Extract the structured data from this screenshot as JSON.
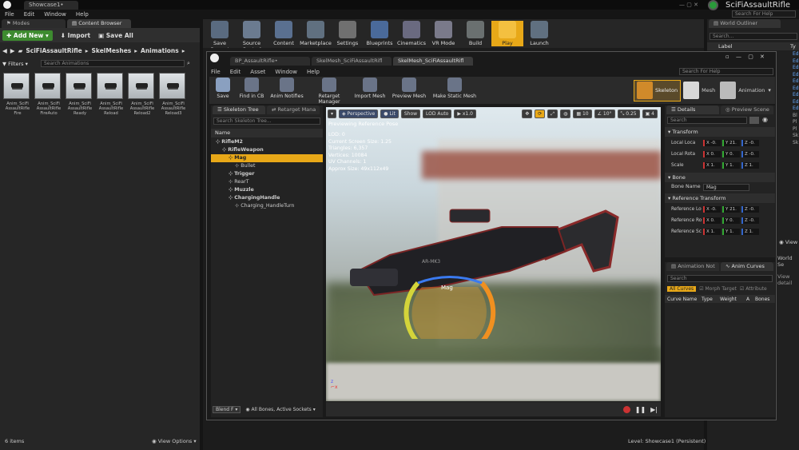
{
  "app": {
    "tab": "Showcase1•",
    "title": "SciFiAssaultRifle",
    "search_help": "Search For Help"
  },
  "menu": [
    "File",
    "Edit",
    "Window",
    "Help"
  ],
  "left": {
    "tabs": [
      "Modes",
      "Content Browser"
    ],
    "add_new": "Add New",
    "import": "Import",
    "save_all": "Save All",
    "path": [
      "SciFiAssaultRifle",
      "SkelMeshes",
      "Animations"
    ],
    "filters": "Filters",
    "search_placeholder": "Search Animations",
    "assets": [
      [
        "Anim_SciFi",
        "AssaultRifle",
        "Fire"
      ],
      [
        "Anim_SciFi",
        "AssaultRifle",
        "FireAuto"
      ],
      [
        "Anim_SciFi",
        "AssaultRifle",
        "Ready"
      ],
      [
        "Anim_SciFi",
        "AssaultRifle",
        "Reload"
      ],
      [
        "Anim_SciFi",
        "AssaultRifle",
        "Reload2"
      ],
      [
        "Anim_SciFi",
        "AssaultRifle",
        "Reload3"
      ]
    ],
    "count": "6 items",
    "view_options": "View Options"
  },
  "toolbar": [
    "Save Current",
    "Source Control",
    "Content",
    "Marketplace",
    "Settings",
    "Blueprints",
    "Cinematics",
    "VR Mode",
    "Build",
    "Play",
    "Launch"
  ],
  "outliner": {
    "title": "World Outliner",
    "search": "Search...",
    "label_col": "Label",
    "type_col": "Ty",
    "right_items": [
      "Ed",
      "Ed",
      "Ed",
      "Ed",
      "Ed",
      "Ed",
      "Ed",
      "Ed",
      "Ed",
      "Bl",
      "Pl",
      "Pl",
      "Sk",
      "Sk"
    ],
    "view": "View",
    "world_se": "World Se",
    "view_detail": "View detail"
  },
  "editor": {
    "tabs": [
      "BP_AssaultRifle•",
      "SkelMesh_SciFiAssaultRifl",
      "SkelMesh_SciFiAssaultRifl"
    ],
    "menu": [
      "File",
      "Edit",
      "Asset",
      "Window",
      "Help"
    ],
    "search_help": "Search For Help",
    "tools": [
      "Save",
      "Find in CB",
      "Anim Notifies",
      "Retarget Manager",
      "Import Mesh",
      "Preview Mesh",
      "Make Static Mesh"
    ],
    "modes": [
      "Skeleton",
      "Mesh",
      "Animation"
    ]
  },
  "skeleton": {
    "tabs": [
      "Skeleton Tree",
      "Retarget Mana"
    ],
    "search": "Search Skeleton Tree...",
    "name_col": "Name",
    "bones": [
      {
        "name": "RifleM2",
        "depth": 0,
        "bold": true
      },
      {
        "name": "RifleWeapon",
        "depth": 1,
        "bold": true
      },
      {
        "name": "Mag",
        "depth": 2,
        "bold": true,
        "selected": true
      },
      {
        "name": "Bullet",
        "depth": 3,
        "bold": false
      },
      {
        "name": "Trigger",
        "depth": 2,
        "bold": true
      },
      {
        "name": "RearT",
        "depth": 2,
        "bold": false
      },
      {
        "name": "Muzzle",
        "depth": 2,
        "bold": true
      },
      {
        "name": "ChargingHandle",
        "depth": 2,
        "bold": true
      },
      {
        "name": "Charging_HandleTurn",
        "depth": 3,
        "bold": false
      }
    ],
    "blend": "Blend F",
    "filter": "All Bones, Active Sockets"
  },
  "viewport": {
    "perspective": "Perspective",
    "lit": "Lit",
    "show": "Show",
    "lod": "LOD Auto",
    "speed": "x1.0",
    "preview": "Previewing Reference Pose",
    "stats": [
      "LOD: 0",
      "Current Screen Size: 1.25",
      "Triangles: 6,357",
      "Vertices: 10084",
      "UV Channels: 1",
      "Approx Size: 49x112x49"
    ],
    "grid": "10",
    "angle": "10°",
    "scale": "0.25",
    "cam": "4",
    "bone_label": "Mag",
    "gun_text": "AR-MK3"
  },
  "details": {
    "tabs": [
      "Details",
      "Preview Scene"
    ],
    "search": "Search",
    "transform": "Transform",
    "rows": [
      {
        "label": "Local Loca",
        "x": "X -0.",
        "y": "Y 21.",
        "z": "Z -0."
      },
      {
        "label": "Local Rota",
        "x": "X 0.",
        "y": "Y 0.",
        "z": "Z -0."
      },
      {
        "label": "Scale",
        "x": "X 1.",
        "y": "Y 1.",
        "z": "Z 1."
      }
    ],
    "bone": "Bone",
    "bone_name_label": "Bone Name",
    "bone_name": "Mag",
    "ref": "Reference Transform",
    "ref_rows": [
      {
        "label": "Reference Lo",
        "x": "X -0.",
        "y": "Y 21.",
        "z": "Z -0."
      },
      {
        "label": "Reference Ro",
        "x": "X 0.",
        "y": "Y 0.",
        "z": "Z -0."
      },
      {
        "label": "Reference Sc",
        "x": "X 1.",
        "y": "Y 1.",
        "z": "Z 1."
      }
    ]
  },
  "curves": {
    "tabs": [
      "Animation Not",
      "Anim Curves"
    ],
    "search": "Search",
    "all": "All Curves",
    "morph": "Morph Target",
    "attr": "Attribute",
    "cols": [
      "Curve Name",
      "Type",
      "Weight",
      "A",
      "Bones"
    ]
  },
  "status": {
    "level": "Level:",
    "level_name": "Showcase1 (Persistent)"
  }
}
